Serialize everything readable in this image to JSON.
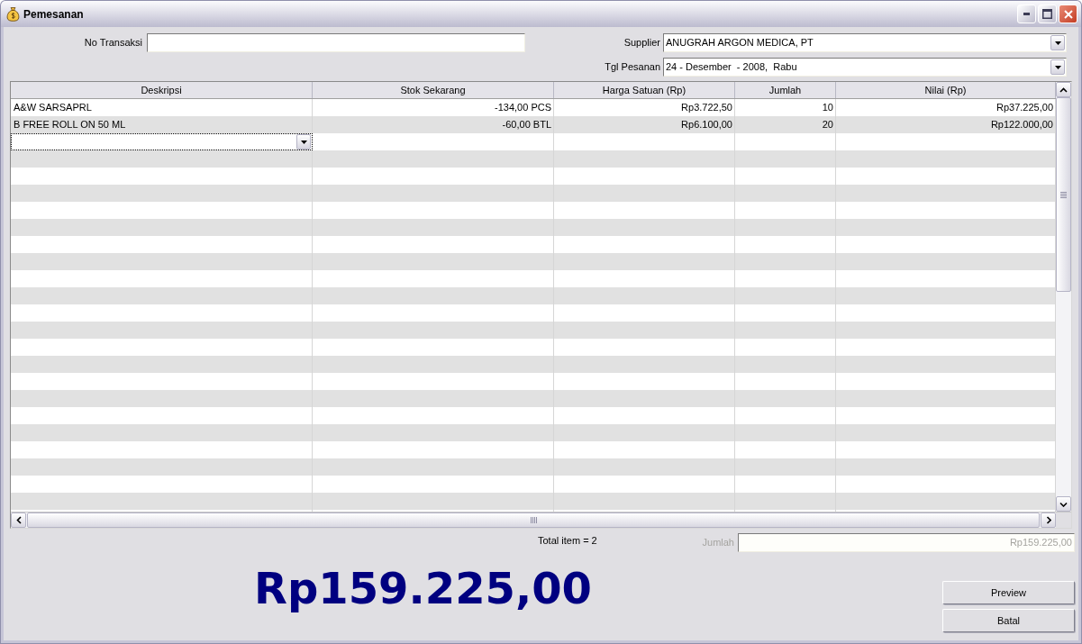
{
  "window": {
    "title": "Pemesanan"
  },
  "form": {
    "no_transaksi": {
      "label": "No Transaksi"
    },
    "supplier": {
      "label": "Supplier",
      "value": "ANUGRAH ARGON MEDICA, PT"
    },
    "tgl_pesanan": {
      "label": "Tgl Pesanan",
      "value": "24 - Desember  - 2008,  Rabu"
    }
  },
  "table": {
    "columns": [
      {
        "label": "Deskripsi",
        "kind": "text"
      },
      {
        "label": "Stok Sekarang",
        "kind": "number"
      },
      {
        "label": "Harga Satuan (Rp)",
        "kind": "number"
      },
      {
        "label": "Jumlah",
        "kind": "number"
      },
      {
        "label": "Nilai (Rp)",
        "kind": "number"
      }
    ],
    "rows": [
      {
        "cells": [
          "A&W SARSAPRL",
          "-134,00 PCS",
          "Rp3.722,50",
          "10",
          "Rp37.225,00"
        ]
      },
      {
        "cells": [
          "B FREE ROLL ON 50 ML",
          "-60,00 BTL",
          "Rp6.100,00",
          "20",
          "Rp122.000,00"
        ]
      }
    ],
    "new_row_editor": true
  },
  "summary": {
    "total_items": "Total item = 2",
    "jumlah": {
      "label": "Jumlah",
      "value": "Rp159.225,00",
      "disabled": true
    },
    "grand_total": "Rp159.225,00"
  },
  "buttons": [
    {
      "label": "Preview"
    },
    {
      "label": "Batal"
    }
  ]
}
